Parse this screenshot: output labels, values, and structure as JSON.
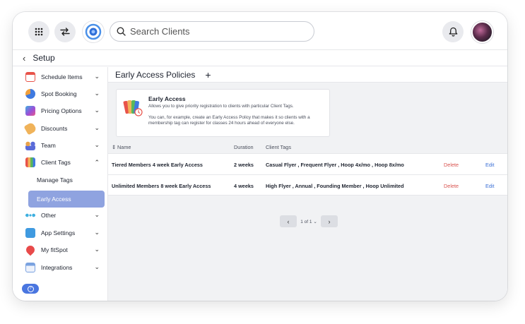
{
  "topbar": {
    "search_placeholder": "Search Clients"
  },
  "setup": {
    "title": "Setup",
    "back_glyph": "‹"
  },
  "sidebar": {
    "items": [
      {
        "label": "Schedule Items",
        "icon": "calendar-icon",
        "color": "#e8534a"
      },
      {
        "label": "Spot Booking",
        "icon": "spot-booking-icon",
        "color": "#3f7ae0"
      },
      {
        "label": "Pricing Options",
        "icon": "pricing-icon",
        "color": "#9b4fd8"
      },
      {
        "label": "Discounts",
        "icon": "discount-tag-icon",
        "color": "#e8a24a"
      },
      {
        "label": "Team",
        "icon": "team-icon",
        "color": "#5a6bd8"
      },
      {
        "label": "Client Tags",
        "icon": "client-tags-icon",
        "color": "#e85a8a"
      },
      {
        "label": "Other",
        "icon": "more-dots-icon",
        "color": "#3fb0e0"
      },
      {
        "label": "App Settings",
        "icon": "app-settings-icon",
        "color": "#3f9ae0"
      },
      {
        "label": "My fitSpot",
        "icon": "location-pin-icon",
        "color": "#e84a4a"
      },
      {
        "label": "Integrations",
        "icon": "integrations-icon",
        "color": "#7aa2e0"
      }
    ],
    "sub_items": [
      {
        "label": "Manage Tags"
      },
      {
        "label": "Early Access"
      }
    ],
    "help_glyph": "?"
  },
  "main": {
    "title": "Early Access Policies",
    "add_glyph": "+",
    "info": {
      "title": "Early Access",
      "desc": "Allows you to give priority registration to clients with particular Client Tags.",
      "example": "You can, for example, create an Early Access Policy that makes it so clients with a membership tag can register for classes 24 hours ahead of everyone else."
    },
    "table": {
      "headers": {
        "name": "Name",
        "duration": "Duration",
        "tags": "Client Tags"
      },
      "rows": [
        {
          "name": "Tiered Members 4 week Early Access",
          "duration": "2 weeks",
          "tags": "Casual Flyer ,  Frequent Flyer ,  Hoop 4x/mo ,  Hoop 8x/mo",
          "delete": "Delete",
          "edit": "Edit"
        },
        {
          "name": "Unlimited Members 8 week Early Access",
          "duration": "4 weeks",
          "tags": "High Flyer ,  Annual ,  Founding Member ,  Hoop Unlimited",
          "delete": "Delete",
          "edit": "Edit"
        }
      ]
    },
    "pager": {
      "text": "1 of 1",
      "prev": "‹",
      "next": "›"
    }
  },
  "colors": {
    "accent": "#8fa3e0",
    "delete": "#d9534f",
    "edit": "#3b6fd6",
    "help": "#4a76e0"
  }
}
